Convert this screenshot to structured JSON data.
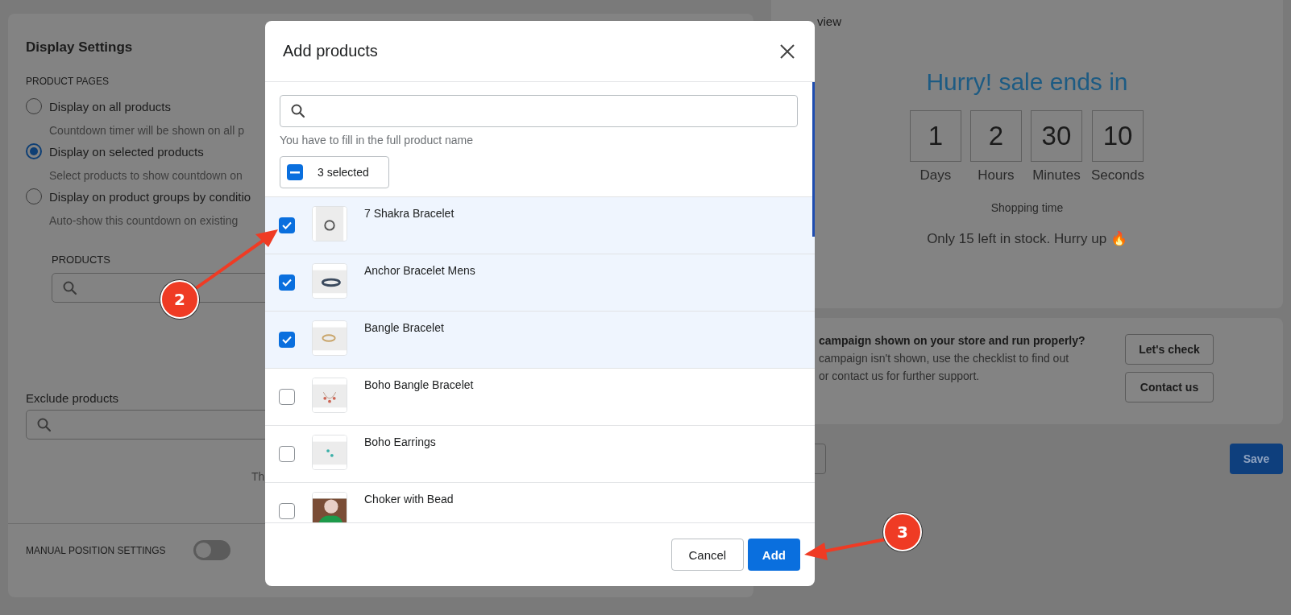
{
  "settings": {
    "title": "Display Settings",
    "section_label": "PRODUCT PAGES",
    "options": [
      {
        "label": "Display on all products",
        "description": "Countdown timer will be shown on all p",
        "selected": false
      },
      {
        "label": "Display on selected products",
        "description": "Select products to show countdown on",
        "selected": true
      },
      {
        "label": "Display on product groups by conditio",
        "description": "Auto-show this countdown on existing",
        "selected": false
      }
    ],
    "products_label": "PRODUCTS",
    "exclude_label": "Exclude products",
    "cut_text": "Th",
    "manual_position": {
      "label": "MANUAL POSITION SETTINGS",
      "on": false
    }
  },
  "preview": {
    "title": "view",
    "headline": "Hurry! sale ends in",
    "countdown": [
      {
        "value": "1",
        "unit": "Days"
      },
      {
        "value": "2",
        "unit": "Hours"
      },
      {
        "value": "30",
        "unit": "Minutes"
      },
      {
        "value": "10",
        "unit": "Seconds"
      }
    ],
    "caption": "Shopping time",
    "stock_text": "Only 15 left in stock. Hurry up 🔥"
  },
  "help": {
    "question": "campaign shown on your store and run properly?",
    "lines": [
      "campaign isn't shown, use the checklist to find out",
      "or contact us for further support."
    ],
    "buttons": [
      "Let's check",
      "Contact us"
    ]
  },
  "footer": {
    "save": "Save"
  },
  "modal": {
    "title": "Add products",
    "hint": "You have to fill in the full product name",
    "bulk": {
      "label": "3 selected",
      "indeterminate": true
    },
    "products": [
      {
        "name": "7 Shakra Bracelet",
        "checked": true,
        "kind": "picture"
      },
      {
        "name": "Anchor Bracelet Mens",
        "checked": true,
        "kind": "picture"
      },
      {
        "name": "Bangle Bracelet",
        "checked": true,
        "kind": "picture"
      },
      {
        "name": "Boho Bangle Bracelet",
        "checked": false,
        "kind": "picture"
      },
      {
        "name": "Boho Earrings",
        "checked": false,
        "kind": "picture"
      },
      {
        "name": "Choker with Bead",
        "checked": false,
        "kind": "picture"
      }
    ],
    "buttons": [
      {
        "label": "Cancel",
        "kind": "secondary"
      },
      {
        "label": "Add",
        "kind": "primary"
      }
    ]
  },
  "annotations": [
    {
      "number": "2"
    },
    {
      "number": "3"
    }
  ]
}
